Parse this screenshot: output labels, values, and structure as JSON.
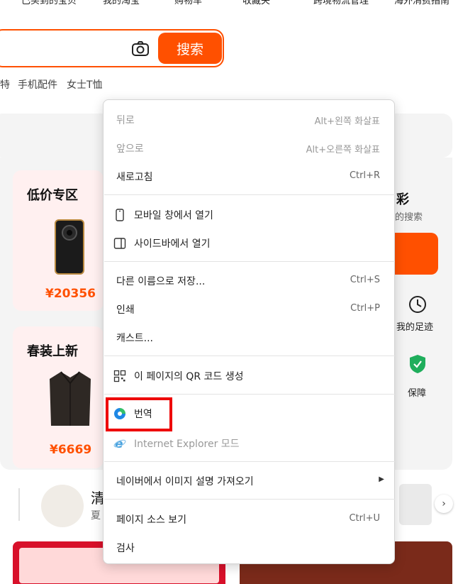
{
  "topnav": {
    "items": [
      "已买到的宝贝",
      "我的淘宝",
      "购物车",
      "收藏夹",
      "跨境物流管理",
      "海外消费指南"
    ]
  },
  "search": {
    "button_label": "搜索",
    "hot_words": [
      "特",
      "手机配件",
      "女士T恤"
    ]
  },
  "cards": {
    "low_price": {
      "title": "低价专区",
      "price": "¥20356"
    },
    "spring_new": {
      "title": "春装上新",
      "price": "¥6669"
    }
  },
  "side": {
    "title": "彩",
    "subtitle": "的搜索",
    "footprint_label": "我的足迹",
    "guarantee_label": "保障"
  },
  "strip": {
    "title_char": "清",
    "sub_char": "夏"
  },
  "context_menu": {
    "items": [
      {
        "label": "뒤로",
        "shortcut": "Alt+왼쪽 화살표",
        "disabled": true
      },
      {
        "label": "앞으로",
        "shortcut": "Alt+오른쪽 화살표",
        "disabled": true
      },
      {
        "label": "새로고침",
        "shortcut": "Ctrl+R",
        "disabled": false
      },
      {
        "label": "모바일 창에서 열기",
        "icon": "mobile-icon"
      },
      {
        "label": "사이드바에서 열기",
        "icon": "sidebar-icon"
      },
      {
        "label": "다른 이름으로 저장...",
        "shortcut": "Ctrl+S"
      },
      {
        "label": "인쇄",
        "shortcut": "Ctrl+P"
      },
      {
        "label": "캐스트..."
      },
      {
        "label": "이 페이지의 QR 코드 생성",
        "icon": "qr-code-icon"
      },
      {
        "label": "번역",
        "icon": "translate-icon"
      },
      {
        "label": "Internet Explorer 모드",
        "icon": "ie-icon",
        "disabled": true
      },
      {
        "label": "네이버에서 이미지 설명 가져오기",
        "has_submenu": true
      },
      {
        "label": "페이지 소스 보기",
        "shortcut": "Ctrl+U"
      },
      {
        "label": "검사"
      }
    ]
  },
  "colors": {
    "accent": "#ff5000",
    "highlight_box": "#ee0000"
  }
}
